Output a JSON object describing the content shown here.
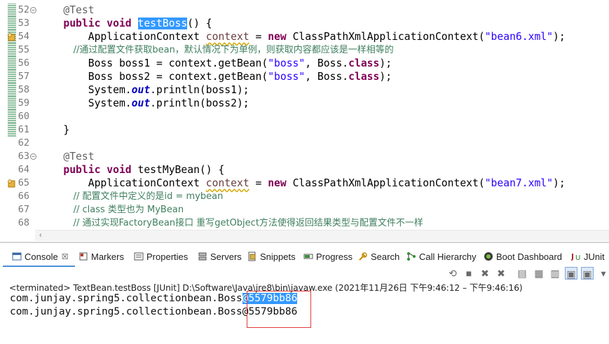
{
  "editor": {
    "lines": [
      {
        "num": "52",
        "fold": "−",
        "marker": true,
        "segments": [
          {
            "t": "    ",
            "c": ""
          },
          {
            "t": "@Test",
            "c": "ann"
          }
        ]
      },
      {
        "num": "53",
        "marker": true,
        "segments": [
          {
            "t": "    ",
            "c": ""
          },
          {
            "t": "public",
            "c": "kw"
          },
          {
            "t": " ",
            "c": ""
          },
          {
            "t": "void",
            "c": "kw"
          },
          {
            "t": " ",
            "c": ""
          },
          {
            "t": "testBoss",
            "c": "sel"
          },
          {
            "t": "() {",
            "c": ""
          }
        ]
      },
      {
        "num": "54",
        "marker": true,
        "warn": true,
        "segments": [
          {
            "t": "        ApplicationContext ",
            "c": ""
          },
          {
            "t": "context",
            "c": "var"
          },
          {
            "t": " = ",
            "c": ""
          },
          {
            "t": "new",
            "c": "kw"
          },
          {
            "t": " ClassPathXmlApplicationContext(",
            "c": ""
          },
          {
            "t": "\"bean6.xml\"",
            "c": "str"
          },
          {
            "t": ");",
            "c": ""
          }
        ]
      },
      {
        "num": "55",
        "marker": true,
        "comment": true,
        "segments": [
          {
            "t": "            ",
            "c": ""
          },
          {
            "t": "//通过配置文件获取bean，默认情况下为单例，则获取内容都应该是一样相等的",
            "c": "cmt"
          }
        ]
      },
      {
        "num": "56",
        "marker": true,
        "segments": [
          {
            "t": "        Boss boss1 = context.getBean(",
            "c": ""
          },
          {
            "t": "\"boss\"",
            "c": "str"
          },
          {
            "t": ", Boss.",
            "c": ""
          },
          {
            "t": "class",
            "c": "kw"
          },
          {
            "t": ");",
            "c": ""
          }
        ]
      },
      {
        "num": "57",
        "marker": true,
        "segments": [
          {
            "t": "        Boss boss2 = context.getBean(",
            "c": ""
          },
          {
            "t": "\"boss\"",
            "c": "str"
          },
          {
            "t": ", Boss.",
            "c": ""
          },
          {
            "t": "class",
            "c": "kw"
          },
          {
            "t": ");",
            "c": ""
          }
        ]
      },
      {
        "num": "58",
        "marker": true,
        "segments": [
          {
            "t": "        System.",
            "c": ""
          },
          {
            "t": "out",
            "c": "fld"
          },
          {
            "t": ".println(boss1);",
            "c": ""
          }
        ]
      },
      {
        "num": "59",
        "marker": true,
        "segments": [
          {
            "t": "        System.",
            "c": ""
          },
          {
            "t": "out",
            "c": "fld"
          },
          {
            "t": ".println(boss2);",
            "c": ""
          }
        ]
      },
      {
        "num": "60",
        "marker": true,
        "segments": [
          {
            "t": "",
            "c": ""
          }
        ]
      },
      {
        "num": "61",
        "marker": true,
        "segments": [
          {
            "t": "    }",
            "c": ""
          }
        ]
      },
      {
        "num": "62",
        "marker": false,
        "segments": [
          {
            "t": "",
            "c": ""
          }
        ]
      },
      {
        "num": "63",
        "fold": "−",
        "marker": false,
        "segments": [
          {
            "t": "    ",
            "c": ""
          },
          {
            "t": "@Test",
            "c": "ann"
          }
        ]
      },
      {
        "num": "64",
        "marker": false,
        "segments": [
          {
            "t": "    ",
            "c": ""
          },
          {
            "t": "public",
            "c": "kw"
          },
          {
            "t": " ",
            "c": ""
          },
          {
            "t": "void",
            "c": "kw"
          },
          {
            "t": " testMyBean() {",
            "c": ""
          }
        ]
      },
      {
        "num": "65",
        "marker": false,
        "warn": true,
        "segments": [
          {
            "t": "        ApplicationContext ",
            "c": ""
          },
          {
            "t": "context",
            "c": "var"
          },
          {
            "t": " = ",
            "c": ""
          },
          {
            "t": "new",
            "c": "kw"
          },
          {
            "t": " ClassPathXmlApplicationContext(",
            "c": ""
          },
          {
            "t": "\"bean7.xml\"",
            "c": "str"
          },
          {
            "t": ");",
            "c": ""
          }
        ]
      },
      {
        "num": "66",
        "marker": false,
        "comment": true,
        "segments": [
          {
            "t": "            ",
            "c": ""
          },
          {
            "t": "// 配置文件中定义的是id = mybean",
            "c": "cmt"
          }
        ]
      },
      {
        "num": "67",
        "marker": false,
        "comment": true,
        "segments": [
          {
            "t": "            ",
            "c": ""
          },
          {
            "t": "// class 类型也为 MyBean",
            "c": "cmt"
          }
        ]
      },
      {
        "num": "68",
        "marker": false,
        "comment": true,
        "segments": [
          {
            "t": "            ",
            "c": ""
          },
          {
            "t": "// 通过实现FactoryBean接口 重写getObject方法使得返回结果类型与配置文件不一样",
            "c": "cmt"
          }
        ]
      }
    ]
  },
  "views": {
    "tabs": [
      {
        "label": "Console",
        "icon": "console-icon",
        "close": "☒",
        "active": true
      },
      {
        "label": "Markers",
        "icon": "markers-icon"
      },
      {
        "label": "Properties",
        "icon": "properties-icon"
      },
      {
        "label": "Servers",
        "icon": "servers-icon"
      },
      {
        "label": "Snippets",
        "icon": "snippets-icon"
      },
      {
        "label": "Progress",
        "icon": "progress-icon"
      },
      {
        "label": "Search",
        "icon": "search-icon"
      },
      {
        "label": "Call Hierarchy",
        "icon": "call-hierarchy-icon"
      },
      {
        "label": "Boot Dashboard",
        "icon": "boot-dashboard-icon"
      },
      {
        "label": "JUnit",
        "icon": "junit-icon"
      }
    ]
  },
  "console": {
    "terminated": "<terminated> TextBean.testBoss [JUnit] D:\\Software\\Java\\jre8\\bin\\javaw.exe  (2021年11月26日 下午9:46:12 – 下午9:46:16)",
    "output": [
      {
        "prefix": "com.junjay.spring5.collectionbean.Boss",
        "hash": "@5579bb86",
        "selected": true
      },
      {
        "prefix": "com.junjay.spring5.collectionbean.Boss",
        "hash": "@5579bb86",
        "selected": false
      }
    ]
  },
  "colors": {
    "keyword": "#7f0055",
    "string": "#2a00ff",
    "comment": "#3f7f5f",
    "selection": "#3399ff",
    "highlight_box": "#e23a3a"
  }
}
